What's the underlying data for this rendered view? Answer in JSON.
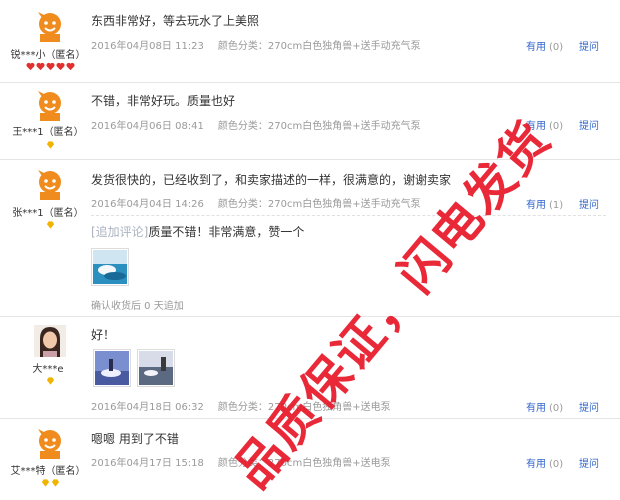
{
  "reviews": [
    {
      "user": "锐***小（匿名）",
      "content": "东西非常好，等去玩水了上美照",
      "date": "2016年04月08日 11:23",
      "sku": "颜色分类：270cm白色独角兽+送手动充气泵",
      "useful_label": "有用",
      "useful_count": "(0)",
      "ask_label": "提问",
      "rank_icons": "red-heart-x5"
    },
    {
      "user": "王***1（匿名）",
      "content": "不错，非常好玩。质量也好",
      "date": "2016年04月06日 08:41",
      "sku": "颜色分类：270cm白色独角兽+送手动充气泵",
      "useful_label": "有用",
      "useful_count": "(0)",
      "ask_label": "提问",
      "rank_icons": "yellow-diamond-x1"
    },
    {
      "user": "张***1（匿名）",
      "content": "发货很快的，已经收到了，和卖家描述的一样，很满意的，谢谢卖家",
      "date": "2016年04月04日 14:26",
      "sku": "颜色分类：270cm白色独角兽+送手动充气泵",
      "useful_label": "有用",
      "useful_count": "(1)",
      "ask_label": "提问",
      "rank_icons": "yellow-diamond-x1",
      "append_tag": "[追加评论]",
      "append_text": "质量不错！非常满意，赞一个",
      "append_time": "确认收货后 0 天追加"
    },
    {
      "user": "大***e",
      "content": "好！",
      "date": "2016年04月18日 06:32",
      "sku": "颜色分类：270cm白色独角兽+送电泵",
      "useful_label": "有用",
      "useful_count": "(0)",
      "ask_label": "提问",
      "rank_icons": "yellow-diamond-x1"
    },
    {
      "user": "艾***特（匿名）",
      "content": "嗯嗯 用到了不错",
      "date": "2016年04月17日 15:18",
      "sku": "颜色分类：270cm白色独角兽+送电泵",
      "useful_label": "有用",
      "useful_count": "(0)",
      "ask_label": "提问",
      "rank_icons": "yellow-diamond-x2"
    }
  ],
  "watermark": "品质保证，闪电发货",
  "colors": {
    "link": "#3366cc",
    "meta": "#9a9a9a",
    "watermark": "#e8182a",
    "avatar": "#f08c1e"
  }
}
